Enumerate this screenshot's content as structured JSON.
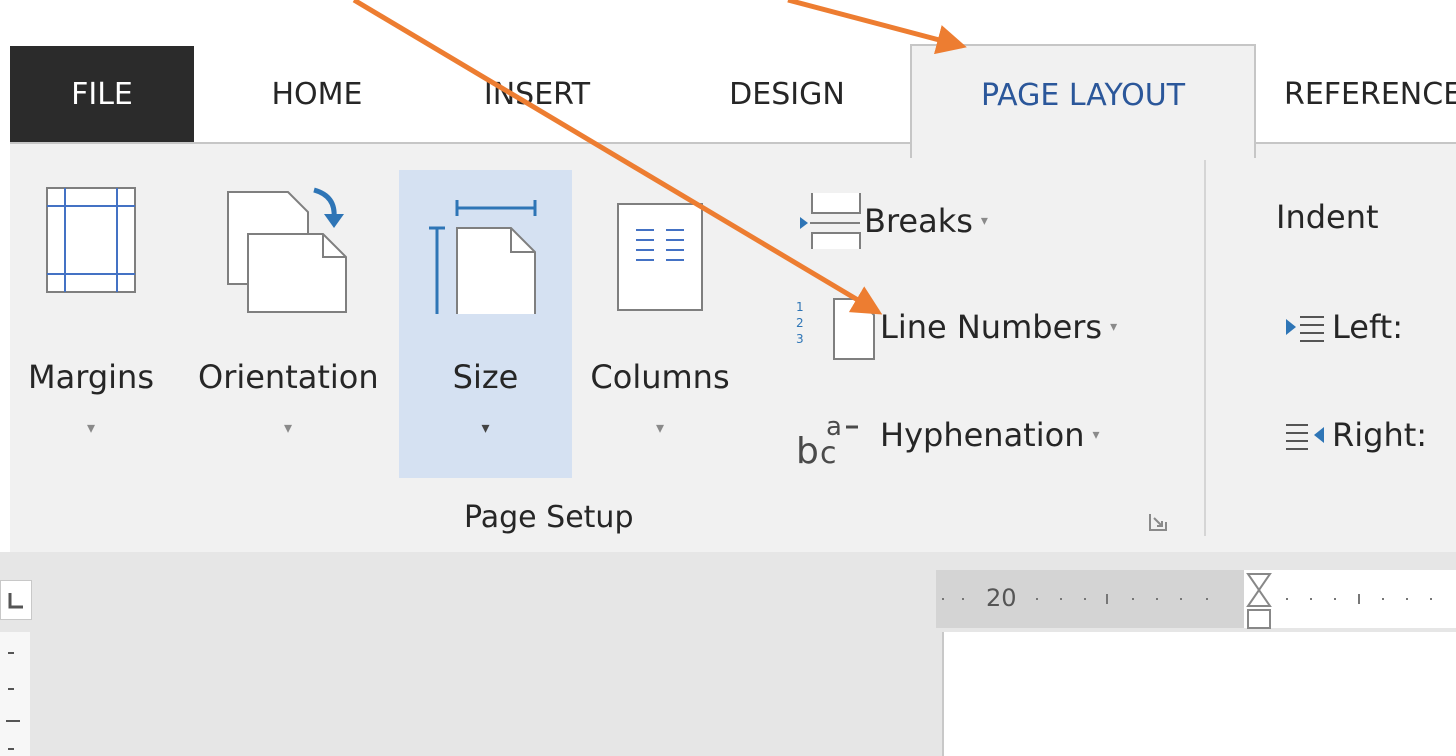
{
  "tabs": {
    "file": "FILE",
    "home": "HOME",
    "insert": "INSERT",
    "design": "DESIGN",
    "page_layout": "PAGE LAYOUT",
    "references": "REFERENCES"
  },
  "page_setup": {
    "group_label": "Page Setup",
    "margins": "Margins",
    "orientation": "Orientation",
    "size": "Size",
    "columns": "Columns",
    "breaks": "Breaks",
    "line_numbers": "Line Numbers",
    "hyphenation": "Hyphenation",
    "dropdown_glyph": "▾"
  },
  "paragraph": {
    "indent_title": "Indent",
    "left": "Left:",
    "right": "Right:"
  },
  "ruler": {
    "marker": "20"
  },
  "colors": {
    "accent_blue": "#2b579a",
    "selected_bg": "#d5e1f2",
    "annotation_arrow": "#ed7d31"
  }
}
